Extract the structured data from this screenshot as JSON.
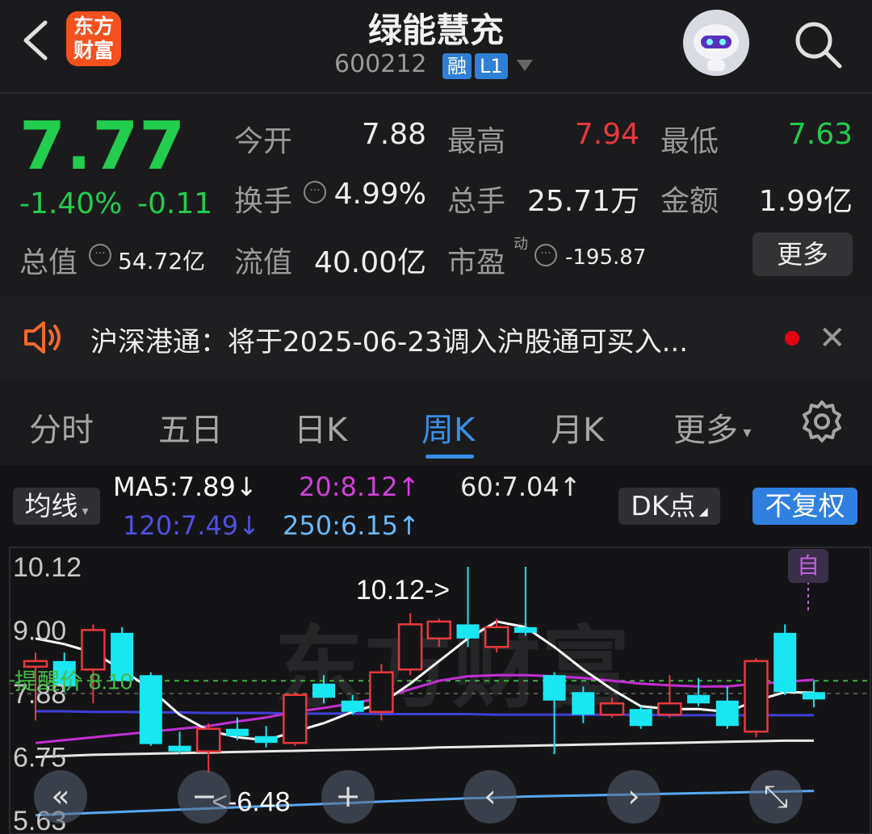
{
  "header": {
    "title": "绿能慧充",
    "code": "600212",
    "badge_margin": "融",
    "badge_level": "L1",
    "logo_line1": "东方",
    "logo_line2": "财富"
  },
  "quote": {
    "price": "7.77",
    "change_pct": "-1.40%",
    "change_abs": "-0.11",
    "open_label": "今开",
    "open": "7.88",
    "high_label": "最高",
    "high": "7.94",
    "low_label": "最低",
    "low": "7.63",
    "turnover_label": "换手",
    "turnover": "4.99%",
    "volume_label": "总手",
    "volume": "25.71万",
    "amount_label": "金额",
    "amount": "1.99亿",
    "mcap_label": "总值",
    "mcap": "54.72亿",
    "float_label": "流值",
    "float": "40.00亿",
    "pe_label": "市盈",
    "pe_sup": "动",
    "pe": "-195.87",
    "more_label": "更多"
  },
  "notice": {
    "text": "沪深港通：将于2025-06-23调入沪股通可买入..."
  },
  "tabs": [
    "分时",
    "五日",
    "日K",
    "周K",
    "月K",
    "更多"
  ],
  "active_tab": "周K",
  "chart": {
    "indicator_label": "均线",
    "ma5": "MA5:7.89↓",
    "ma20": "20:8.12↑",
    "ma60": "60:7.04↑",
    "ma120": "120:7.49↓",
    "ma250": "250:6.15↑",
    "dk_label": "DK点",
    "fq_label": "不复权",
    "y_labels": [
      "10.12",
      "9.00",
      "7.88",
      "6.75",
      "5.63"
    ],
    "alert_label": "提醒价 8.10",
    "max_mark": "10.12->",
    "min_mark": "<-6.48",
    "self_label": "自",
    "watermark": "东方财富",
    "colors": {
      "up": "#e8383d",
      "down": "#19e6f0",
      "ma5": "#ffffff",
      "ma20": "#c030d0",
      "ma60": "#e8e8e8",
      "ma120": "#4040d8",
      "ma250": "#5aa8f0"
    }
  },
  "chart_data": {
    "type": "candlestick",
    "ylim": [
      5.63,
      10.12
    ],
    "candles": [
      {
        "o": 8.35,
        "c": 8.45,
        "h": 8.6,
        "l": 7.4
      },
      {
        "o": 8.45,
        "c": 8.0,
        "h": 8.6,
        "l": 7.9
      },
      {
        "o": 8.3,
        "c": 9.0,
        "h": 9.1,
        "l": 7.7
      },
      {
        "o": 8.95,
        "c": 8.1,
        "h": 9.05,
        "l": 8.0
      },
      {
        "o": 8.2,
        "c": 6.98,
        "h": 8.25,
        "l": 6.95
      },
      {
        "o": 6.95,
        "c": 6.85,
        "h": 7.2,
        "l": 6.8
      },
      {
        "o": 6.85,
        "c": 7.25,
        "h": 7.35,
        "l": 6.48
      },
      {
        "o": 7.25,
        "c": 7.12,
        "h": 7.45,
        "l": 7.05
      },
      {
        "o": 7.12,
        "c": 7.0,
        "h": 7.3,
        "l": 6.92
      },
      {
        "o": 7.0,
        "c": 7.85,
        "h": 7.9,
        "l": 6.95
      },
      {
        "o": 8.05,
        "c": 7.8,
        "h": 8.2,
        "l": 7.7
      },
      {
        "o": 7.75,
        "c": 7.55,
        "h": 7.85,
        "l": 7.5
      },
      {
        "o": 7.55,
        "c": 8.25,
        "h": 8.4,
        "l": 7.4
      },
      {
        "o": 8.3,
        "c": 9.1,
        "h": 9.3,
        "l": 8.2
      },
      {
        "o": 8.85,
        "c": 9.15,
        "h": 9.2,
        "l": 8.7
      },
      {
        "o": 9.1,
        "c": 8.85,
        "h": 10.12,
        "l": 8.7
      },
      {
        "o": 8.7,
        "c": 9.05,
        "h": 9.2,
        "l": 8.6
      },
      {
        "o": 9.05,
        "c": 8.95,
        "h": 10.12,
        "l": 8.9
      },
      {
        "o": 8.2,
        "c": 7.75,
        "h": 8.25,
        "l": 6.8
      },
      {
        "o": 7.9,
        "c": 7.5,
        "h": 8.0,
        "l": 7.35
      },
      {
        "o": 7.5,
        "c": 7.7,
        "h": 7.8,
        "l": 7.45
      },
      {
        "o": 7.6,
        "c": 7.3,
        "h": 7.65,
        "l": 7.25
      },
      {
        "o": 7.5,
        "c": 7.7,
        "h": 8.2,
        "l": 7.45
      },
      {
        "o": 7.85,
        "c": 7.7,
        "h": 8.15,
        "l": 7.65
      },
      {
        "o": 7.75,
        "c": 7.3,
        "h": 8.0,
        "l": 7.25
      },
      {
        "o": 7.2,
        "c": 8.45,
        "h": 8.5,
        "l": 7.1
      },
      {
        "o": 8.95,
        "c": 7.9,
        "h": 9.1,
        "l": 7.85
      },
      {
        "o": 7.9,
        "c": 7.77,
        "h": 8.1,
        "l": 7.63
      }
    ],
    "ma5": [
      8.85,
      8.75,
      8.6,
      8.3,
      7.95,
      7.5,
      7.22,
      7.1,
      7.05,
      7.2,
      7.35,
      7.55,
      7.7,
      8.05,
      8.45,
      8.85,
      9.15,
      9.05,
      8.7,
      8.3,
      7.95,
      7.65,
      7.6,
      7.6,
      7.55,
      7.75,
      7.9,
      7.89
    ],
    "ma20": [
      7.0,
      7.05,
      7.1,
      7.15,
      7.2,
      7.25,
      7.3,
      7.38,
      7.45,
      7.55,
      7.62,
      7.7,
      7.8,
      7.95,
      8.1,
      8.18,
      8.2,
      8.2,
      8.18,
      8.15,
      8.1,
      8.05,
      8.02,
      8.0,
      8.0,
      8.05,
      8.08,
      8.12
    ],
    "ma60": [
      6.75,
      6.77,
      6.79,
      6.8,
      6.81,
      6.82,
      6.83,
      6.84,
      6.85,
      6.86,
      6.87,
      6.88,
      6.89,
      6.9,
      6.92,
      6.93,
      6.94,
      6.95,
      6.96,
      6.97,
      6.98,
      6.99,
      7.0,
      7.01,
      7.02,
      7.03,
      7.04,
      7.04
    ],
    "ma120": [
      7.56,
      7.56,
      7.55,
      7.55,
      7.54,
      7.54,
      7.53,
      7.53,
      7.53,
      7.52,
      7.52,
      7.52,
      7.51,
      7.51,
      7.51,
      7.51,
      7.5,
      7.5,
      7.5,
      7.5,
      7.5,
      7.5,
      7.49,
      7.49,
      7.49,
      7.49,
      7.49,
      7.49
    ],
    "ma250": [
      5.72,
      5.74,
      5.76,
      5.78,
      5.8,
      5.82,
      5.84,
      5.86,
      5.88,
      5.9,
      5.92,
      5.94,
      5.96,
      5.98,
      6.0,
      6.02,
      6.03,
      6.05,
      6.06,
      6.07,
      6.08,
      6.09,
      6.1,
      6.11,
      6.12,
      6.13,
      6.14,
      6.15
    ],
    "alert_price": 8.1
  },
  "chart_nav": [
    "«",
    "−",
    "+",
    "‹",
    "›",
    "⤡"
  ]
}
